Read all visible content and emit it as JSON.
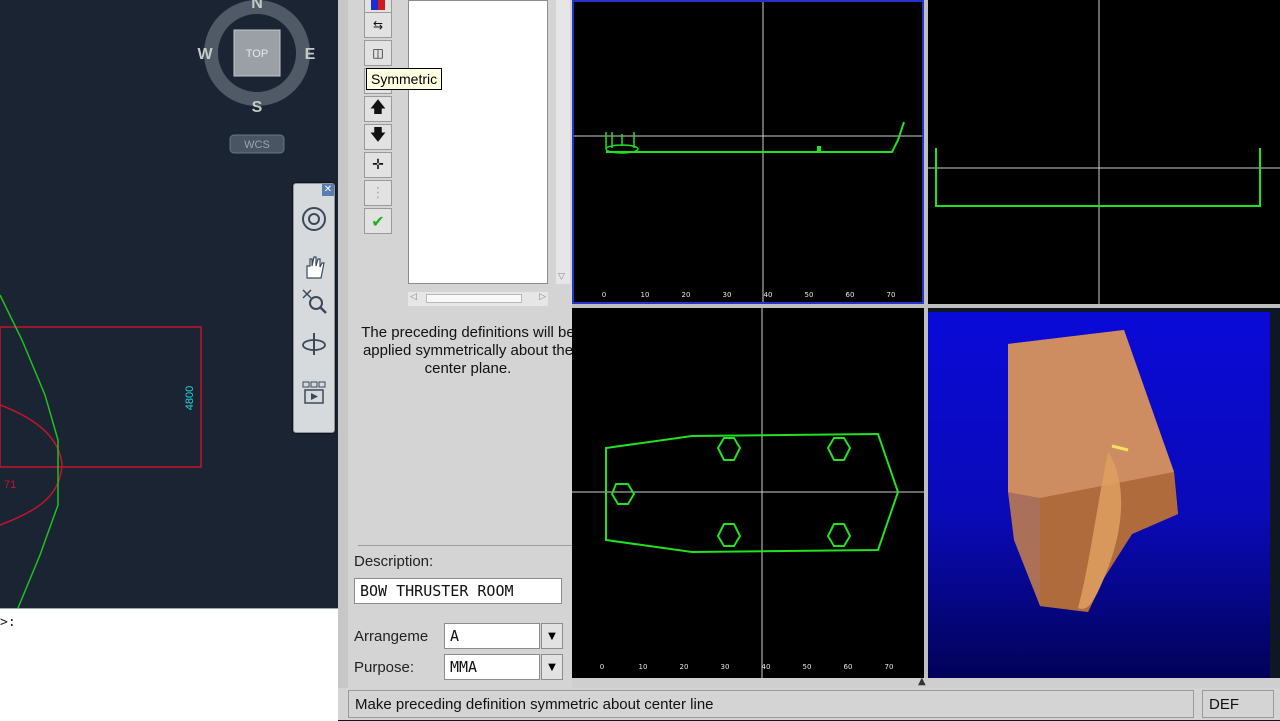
{
  "cad": {
    "compass": {
      "north": "N",
      "south": "S",
      "east": "E",
      "west": "W",
      "top_label": "TOP",
      "wcs_label": "WCS"
    },
    "dimension_label": "4800",
    "side_label": "71",
    "command_prompt": ">:",
    "navbar": {
      "tools": [
        "steering-wheel-icon",
        "pan-icon",
        "zoom-icon",
        "orbit-icon",
        "showmotion-icon"
      ]
    }
  },
  "dialog": {
    "toolbar": {
      "tooltip": "Symmetric",
      "buttons": [
        "color-icon",
        "mirror-icon",
        "split-icon",
        "symmetric-icon",
        "move-up-icon",
        "move-down-icon",
        "add-point-icon",
        "disabled-icon",
        "check-icon"
      ]
    },
    "help_text": "The preceding definitions will be applied symmetrically about the center plane.",
    "description_label": "Description:",
    "description_value": "BOW THRUSTER ROOM",
    "arrangement_label": "Arrangeme",
    "arrangement_value": "A",
    "purpose_label": "Purpose:",
    "purpose_value": "MMA"
  },
  "views": {
    "ruler_ticks": [
      "0",
      "10",
      "20",
      "30",
      "40",
      "50",
      "60",
      "70"
    ],
    "colors": {
      "profile": "#22e022",
      "crosshair": "#d0d0d0",
      "active_border": "#2233cc",
      "render_bg": "#0a0ad8",
      "solid": "#c8824a"
    }
  },
  "status": {
    "message": "Make preceding definition symmetric about center line",
    "mode": "DEF"
  }
}
